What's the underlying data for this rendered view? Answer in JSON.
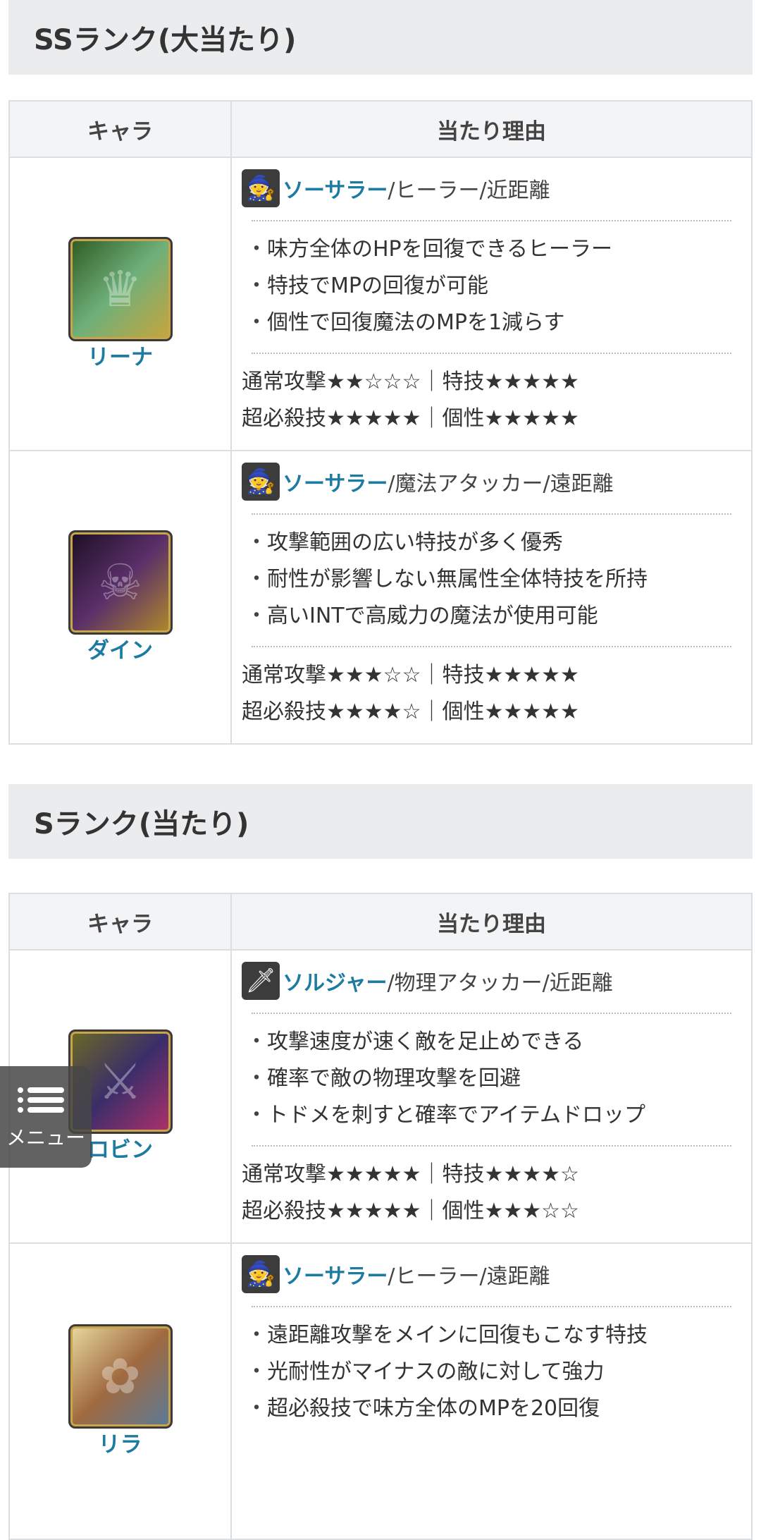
{
  "header": {
    "character": "キャラ",
    "reason": "当たり理由"
  },
  "ss_section": {
    "title": "SSランク(大当たり)",
    "rows": [
      {
        "name": "リーナ",
        "portrait_color": "#4a7a3a",
        "role_icon": "sorcerer-icon",
        "role_class": "ソーサラー",
        "role_rest": "/ヒーラー/近距離",
        "points": [
          "味方全体のHPを回復できるヒーラー",
          "特技でMPの回復が可能",
          "個性で回復魔法のMPを1減らす"
        ],
        "stats_line1": "通常攻撃★★☆☆☆｜特技★★★★★",
        "stats_line2": "超必殺技★★★★★｜個性★★★★★"
      },
      {
        "name": "ダイン",
        "portrait_color": "#3a1f3e",
        "role_icon": "sorcerer-icon",
        "role_class": "ソーサラー",
        "role_rest": "/魔法アタッカー/遠距離",
        "points": [
          "攻撃範囲の広い特技が多く優秀",
          "耐性が影響しない無属性全体特技を所持",
          "高いINTで高威力の魔法が使用可能"
        ],
        "stats_line1": "通常攻撃★★★☆☆｜特技★★★★★",
        "stats_line2": "超必殺技★★★★☆｜個性★★★★★"
      }
    ]
  },
  "s_section": {
    "title": "Sランク(当たり)",
    "rows": [
      {
        "name": "ロビン",
        "portrait_color": "#5a5a2a",
        "role_icon": "soldier-icon",
        "role_class": "ソルジャー",
        "role_rest": "/物理アタッカー/近距離",
        "points": [
          "攻撃速度が速く敵を足止めできる",
          "確率で敵の物理攻撃を回避",
          "トドメを刺すと確率でアイテムドロップ"
        ],
        "stats_line1": "通常攻撃★★★★★｜特技★★★★☆",
        "stats_line2": "超必殺技★★★★★｜個性★★★☆☆"
      },
      {
        "name": "リラ",
        "portrait_color": "#b08a55",
        "role_icon": "sorcerer-icon",
        "role_class": "ソーサラー",
        "role_rest": "/ヒーラー/遠距離",
        "points": [
          "遠距離攻撃をメインに回復もこなす特技",
          "光耐性がマイナスの敵に対して強力",
          "超必殺技で味方全体のMPを20回復"
        ]
      }
    ]
  },
  "menu": {
    "label": "メニュー",
    "icon": "hamburger-icon"
  }
}
